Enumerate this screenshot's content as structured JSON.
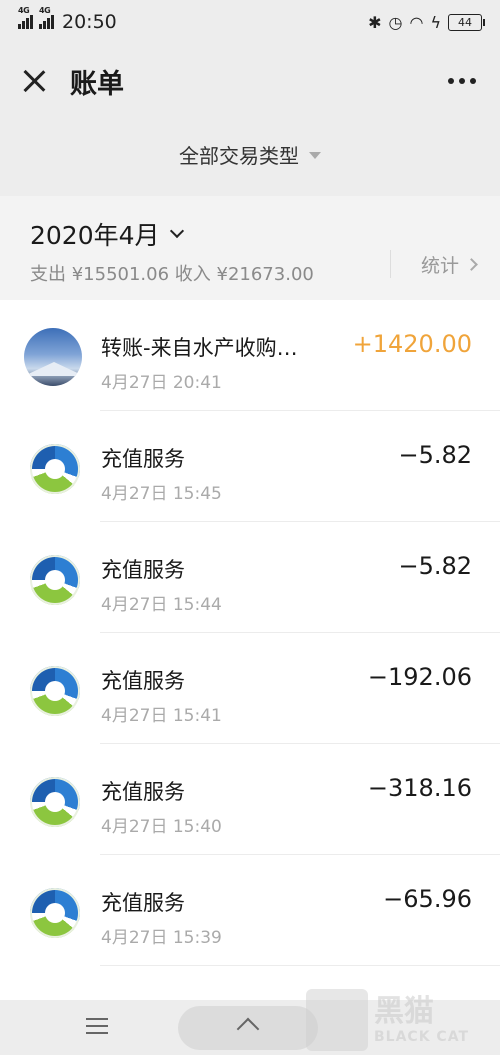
{
  "status_bar": {
    "network_1": "4G",
    "network_2": "4G",
    "time": "20:50",
    "battery": "44"
  },
  "header": {
    "title": "账单"
  },
  "filter": {
    "label": "全部交易类型"
  },
  "summary": {
    "month": "2020年4月",
    "totals": "支出 ¥15501.06 收入 ¥21673.00",
    "stats_label": "统计"
  },
  "transactions": [
    {
      "title": "转账-来自水产收购…",
      "time": "4月27日 20:41",
      "amount": "+1420.00",
      "type": "income"
    },
    {
      "title": "充值服务",
      "time": "4月27日 15:45",
      "amount": "−5.82",
      "type": "expense"
    },
    {
      "title": "充值服务",
      "time": "4月27日 15:44",
      "amount": "−5.82",
      "type": "expense"
    },
    {
      "title": "充值服务",
      "time": "4月27日 15:41",
      "amount": "−192.06",
      "type": "expense"
    },
    {
      "title": "充值服务",
      "time": "4月27日 15:40",
      "amount": "−318.16",
      "type": "expense"
    },
    {
      "title": "充值服务",
      "time": "4月27日 15:39",
      "amount": "−65.96",
      "type": "expense"
    }
  ],
  "watermark": {
    "cn": "黑猫",
    "en": "BLACK CAT"
  },
  "colors": {
    "income": "#f0a43a",
    "background": "#ededed"
  }
}
